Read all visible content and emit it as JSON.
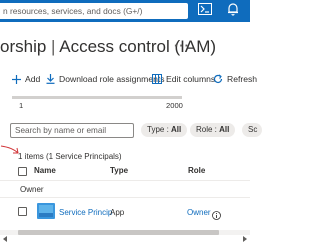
{
  "topbar": {
    "search_text": "n resources, services, and docs (G+/)",
    "accent": "#0f6cbd",
    "icons": [
      "cloud-shell-icon",
      "notifications-icon"
    ]
  },
  "header": {
    "title_part1": "orship",
    "separator": " | ",
    "title_part2": "Access control (IAM)",
    "more_label": "···"
  },
  "commands": {
    "add": "Add",
    "download": "Download role assignments",
    "edit_columns": "Edit columns",
    "refresh": "Refresh"
  },
  "slider": {
    "min_label": "1",
    "max_label": "2000",
    "value_fraction": 0.0
  },
  "filters": {
    "search_placeholder": "Search by name or email",
    "type_label": "Type : ",
    "type_value": "All",
    "role_label": "Role : ",
    "role_value": "All",
    "third_label": "Sc"
  },
  "results": {
    "count_text": "1 items (1 Service Principals)"
  },
  "table": {
    "columns": [
      "Name",
      "Type",
      "Role"
    ],
    "group_label": "Owner",
    "rows": [
      {
        "name": "Service Princip",
        "type": "App",
        "role": "Owner"
      }
    ]
  }
}
